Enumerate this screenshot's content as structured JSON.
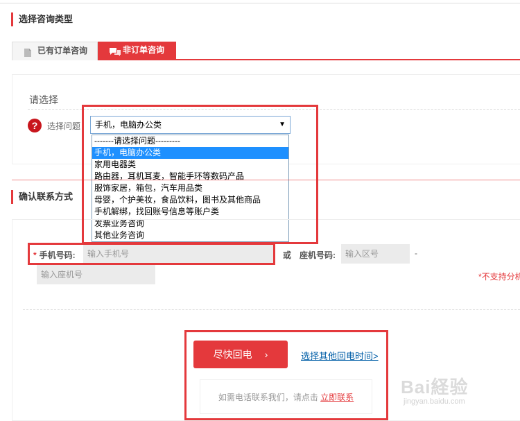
{
  "section1": {
    "title": "选择咨询类型"
  },
  "tabs": [
    {
      "label": "已有订单咨询"
    },
    {
      "label": "非订单咨询"
    }
  ],
  "panel": {
    "label": "请选择"
  },
  "question": {
    "label": "选择问题：",
    "selected": "手机，电脑办公类",
    "options": [
      "-------请选择问题---------",
      "手机，电脑办公类",
      "家用电器类",
      "路由器，耳机耳麦，智能手环等数码产品",
      "服饰家居，箱包，汽车用品类",
      "母婴，个护美妆，食品饮料，图书及其他商品",
      "手机解绑，找回账号信息等账户类",
      "发票业务咨询",
      "其他业务咨询"
    ],
    "highlighted_index": 1
  },
  "section2": {
    "title": "确认联系方式"
  },
  "contact": {
    "mobile_label": "手机号码:",
    "mobile_placeholder": "输入手机号",
    "or_label": "或",
    "landline_label": "座机号码:",
    "area_placeholder": "输入区号",
    "separator": "-",
    "landline_placeholder": "输入座机号",
    "not_support": "*不支持分机"
  },
  "callback": {
    "button_label": "尽快回电",
    "other_time_link": "选择其他回电时间>",
    "phone_text": "如需电话联系我们，请点击",
    "phone_link": "立即联系"
  },
  "watermark": {
    "line1": "Bai経验",
    "line2": "jingyan.baidu.com"
  },
  "colors": {
    "accent": "#e4393c",
    "link": "#005ea7"
  }
}
